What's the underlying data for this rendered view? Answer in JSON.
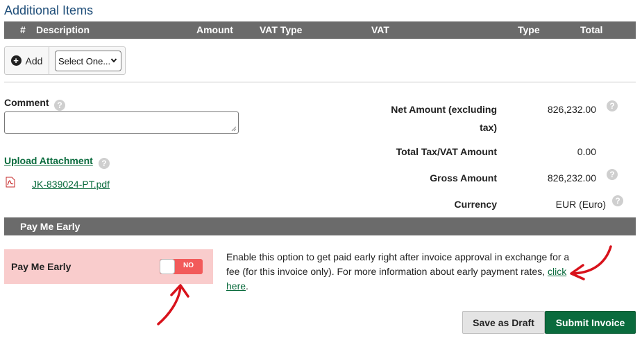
{
  "additional_items": {
    "title": "Additional Items",
    "columns": {
      "num": "#",
      "description": "Description",
      "amount": "Amount",
      "vat_type": "VAT Type",
      "vat": "VAT",
      "type": "Type",
      "total": "Total"
    },
    "add_label": "Add",
    "select_value": "Select One..."
  },
  "comment": {
    "label": "Comment",
    "value": ""
  },
  "attachment": {
    "upload_label": "Upload Attachment",
    "file_name": "JK-839024-PT.pdf"
  },
  "summary": {
    "net_label_line1": "Net Amount (excluding",
    "net_label_line2": "tax)",
    "net_value": "826,232.00",
    "tax_label": "Total Tax/VAT Amount",
    "tax_value": "0.00",
    "gross_label": "Gross Amount",
    "gross_value": "826,232.00",
    "currency_label": "Currency",
    "currency_value": "EUR (Euro)"
  },
  "pay_me_early": {
    "header": "Pay Me Early",
    "toggle_label": "Pay Me Early",
    "toggle_state": "NO",
    "info_text": "Enable this option to get paid early right after invoice approval in exchange for a fee (for this invoice only). For more information about early payment rates,",
    "link_part1": "click",
    "link_part2": "here",
    "period": "."
  },
  "actions": {
    "save_draft": "Save as Draft",
    "submit": "Submit Invoice"
  },
  "colors": {
    "header_bg": "#6b6b6b",
    "primary_green": "#0a6b3d",
    "pay_box_bg": "#f9cccc",
    "toggle_off": "#f25a5a",
    "annotation_red": "#d8121b"
  },
  "icons": [
    "plus-circle-icon",
    "chevron-down-icon",
    "help-icon",
    "pdf-icon",
    "annotation-arrow-icon"
  ]
}
